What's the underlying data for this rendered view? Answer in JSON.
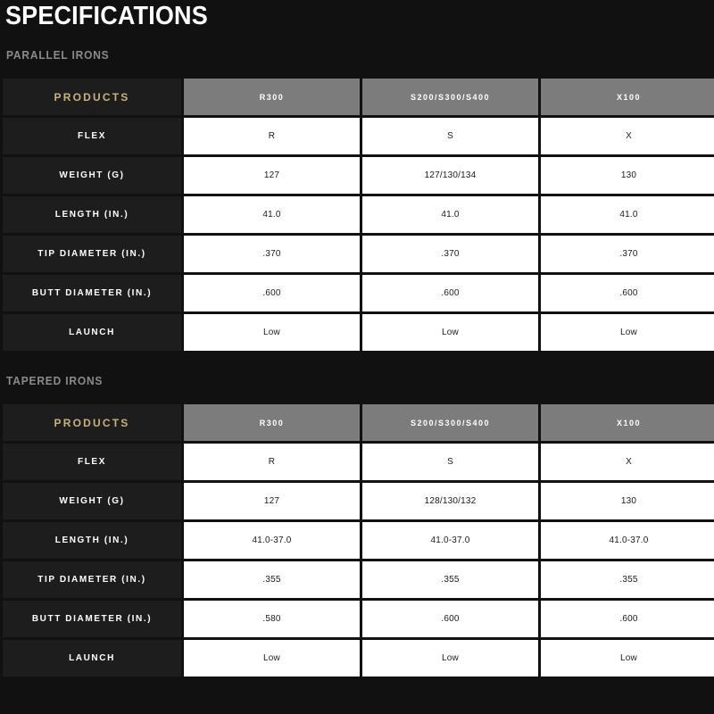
{
  "page": {
    "title": "SPECIFICATIONS",
    "background_color": "#111111",
    "accent_color": "#c8b27d",
    "header_cell_color": "#7c7c7c",
    "label_cell_color": "#1d1d1d",
    "data_cell_color": "#ffffff"
  },
  "sections": [
    {
      "label": "PARALLEL IRONS",
      "table": {
        "corner_label": "PRODUCTS",
        "columns": [
          "R300",
          "S200/S300/S400",
          "X100"
        ],
        "rows": [
          {
            "label": "FLEX",
            "values": [
              "R",
              "S",
              "X"
            ]
          },
          {
            "label": "WEIGHT (G)",
            "values": [
              "127",
              "127/130/134",
              "130"
            ]
          },
          {
            "label": "LENGTH (IN.)",
            "values": [
              "41.0",
              "41.0",
              "41.0"
            ]
          },
          {
            "label": "TIP DIAMETER (IN.)",
            "values": [
              ".370",
              ".370",
              ".370"
            ]
          },
          {
            "label": "BUTT DIAMETER (IN.)",
            "values": [
              ".600",
              ".600",
              ".600"
            ]
          },
          {
            "label": "LAUNCH",
            "values": [
              "Low",
              "Low",
              "Low"
            ]
          }
        ]
      }
    },
    {
      "label": "TAPERED IRONS",
      "table": {
        "corner_label": "PRODUCTS",
        "columns": [
          "R300",
          "S200/S300/S400",
          "X100"
        ],
        "rows": [
          {
            "label": "FLEX",
            "values": [
              "R",
              "S",
              "X"
            ]
          },
          {
            "label": "WEIGHT (G)",
            "values": [
              "127",
              "128/130/132",
              "130"
            ]
          },
          {
            "label": "LENGTH (IN.)",
            "values": [
              "41.0-37.0",
              "41.0-37.0",
              "41.0-37.0"
            ]
          },
          {
            "label": "TIP DIAMETER (IN.)",
            "values": [
              ".355",
              ".355",
              ".355"
            ]
          },
          {
            "label": "BUTT DIAMETER (IN.)",
            "values": [
              ".580",
              ".600",
              ".600"
            ]
          },
          {
            "label": "LAUNCH",
            "values": [
              "Low",
              "Low",
              "Low"
            ]
          }
        ]
      }
    }
  ]
}
